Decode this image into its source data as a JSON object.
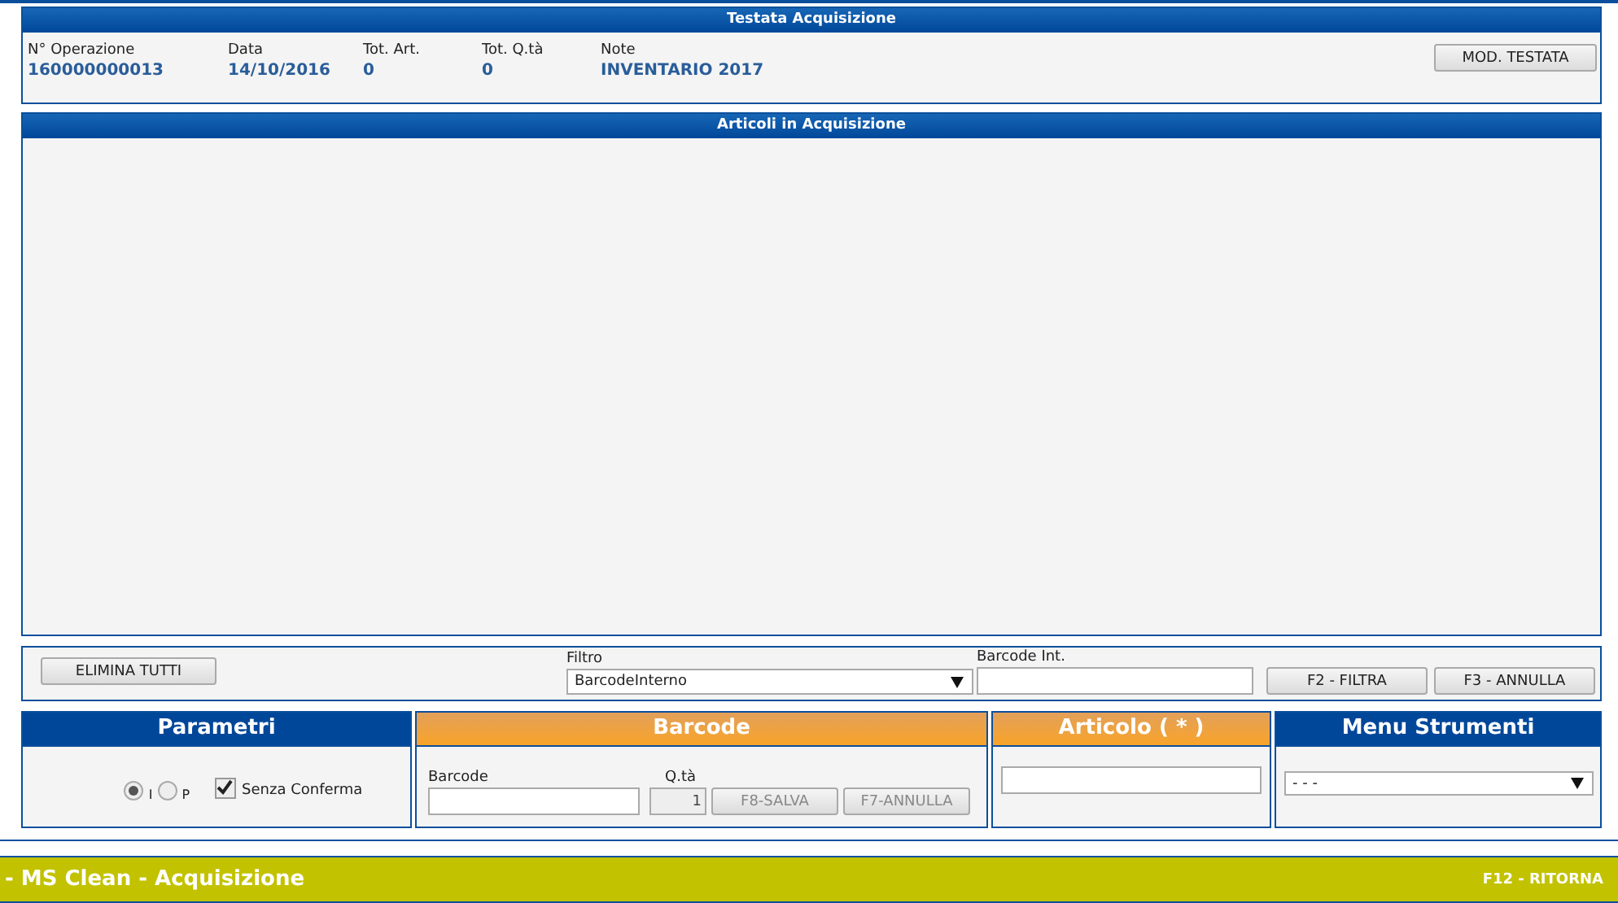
{
  "header_panel": {
    "title": "Testata Acquisizione",
    "fields": [
      {
        "label": "N° Operazione",
        "value": "160000000013"
      },
      {
        "label": "Data",
        "value": "14/10/2016"
      },
      {
        "label": "Tot. Art.",
        "value": "0"
      },
      {
        "label": "Tot. Q.tà",
        "value": "0"
      },
      {
        "label": "Note",
        "value": "INVENTARIO 2017"
      }
    ],
    "button": "MOD. TESTATA"
  },
  "articles_panel": {
    "title": "Articoli in Acquisizione"
  },
  "filter_bar": {
    "delete_button": "ELIMINA TUTTI",
    "filter_label": "Filtro",
    "filter_value": "BarcodeInterno",
    "barcode_label": "Barcode Int.",
    "buttons": [
      "F2 - FILTRA",
      "F3 - ANNULLA"
    ]
  },
  "parameters_panel": {
    "title": "Parametri",
    "radios": [
      {
        "label": "I",
        "selected": true
      },
      {
        "label": "P",
        "selected": false
      }
    ],
    "checkbox": {
      "label": "Senza Conferma",
      "checked": true
    }
  },
  "barcode_panel": {
    "title": "Barcode",
    "barcode_label": "Barcode",
    "qty_label": "Q.tà",
    "qty_value": "1",
    "qty_disabled": true,
    "buttons": [
      {
        "label": "F8-SALVA",
        "disabled": true
      },
      {
        "label": "F7-ANNULLA",
        "disabled": true
      }
    ]
  },
  "article_panel": {
    "title": "Articolo ( * )"
  },
  "tools_panel": {
    "title": "Menu Strumenti",
    "select_value": "- - -"
  },
  "footer": {
    "title": "- MS Clean - Acquisizione",
    "shortcut": "F12 - RITORNA"
  }
}
